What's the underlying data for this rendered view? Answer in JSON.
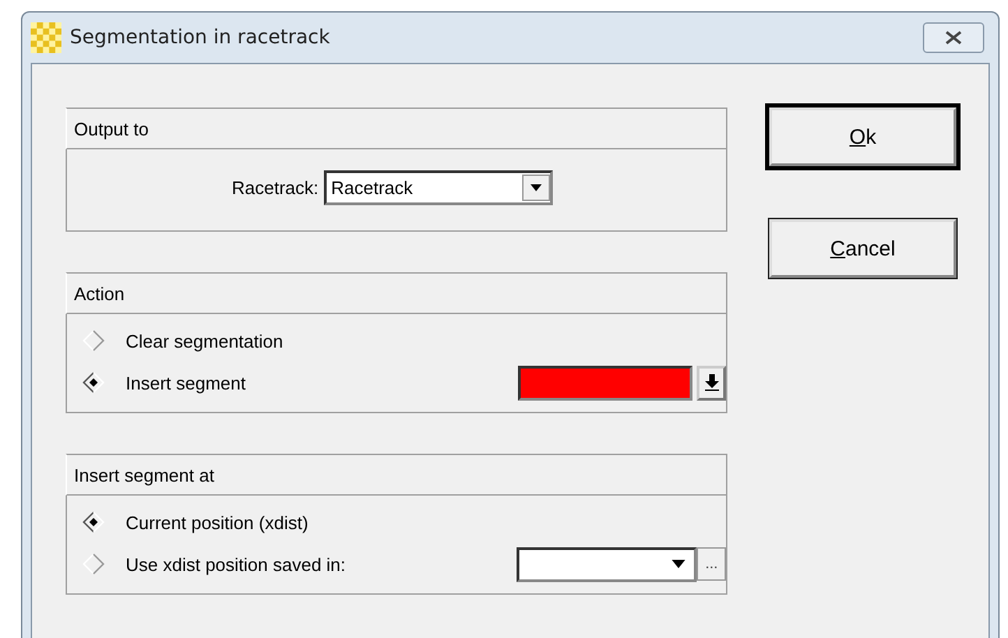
{
  "window": {
    "title": "Segmentation in racetrack"
  },
  "groups": [
    {
      "title": "Output to",
      "rows": [
        {
          "kind": "combo",
          "label": "Racetrack:",
          "value": "Racetrack"
        }
      ]
    },
    {
      "title": "Action",
      "rows": [
        {
          "kind": "radio",
          "label": "Clear segmentation",
          "selected": false
        },
        {
          "kind": "radio",
          "label": "Insert segment",
          "selected": true,
          "widget": {
            "kind": "color",
            "color": "#ff0000"
          }
        }
      ]
    },
    {
      "title": "Insert segment at",
      "rows": [
        {
          "kind": "radio",
          "label": "Current position (xdist)",
          "selected": true
        },
        {
          "kind": "radio",
          "label": "Use xdist position saved in:",
          "selected": false,
          "widget": {
            "kind": "combo-browse",
            "browse": "..."
          }
        }
      ]
    }
  ],
  "buttons": [
    {
      "label": "Ok",
      "default": true
    },
    {
      "label": "Cancel",
      "default": false
    }
  ]
}
